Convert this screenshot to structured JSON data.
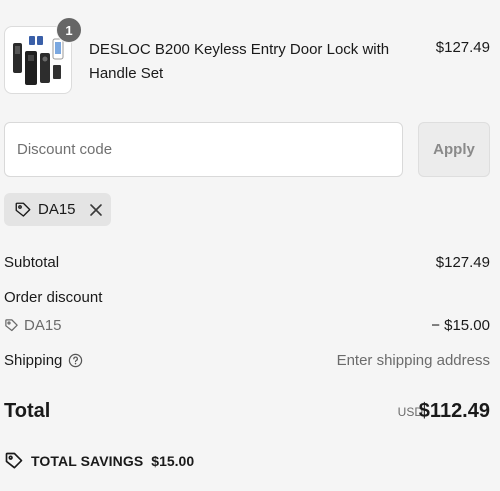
{
  "line_item": {
    "quantity": "1",
    "title": "DESLOC B200 Keyless Entry Door Lock with Handle Set",
    "price": "$127.49"
  },
  "discount": {
    "placeholder": "Discount code",
    "apply_label": "Apply",
    "applied_code": "DA15"
  },
  "summary": {
    "subtotal_label": "Subtotal",
    "subtotal_value": "$127.49",
    "order_discount_label": "Order discount",
    "discount_code": "DA15",
    "discount_value": "− $15.00",
    "shipping_label": "Shipping",
    "shipping_value": "Enter shipping address",
    "total_label": "Total",
    "currency": "USD",
    "total_value": "$112.49",
    "savings_label": "TOTAL SAVINGS",
    "savings_value": "$15.00"
  },
  "icons": {
    "tag": "tag-icon",
    "remove": "close-icon",
    "help": "help-circle-icon"
  }
}
